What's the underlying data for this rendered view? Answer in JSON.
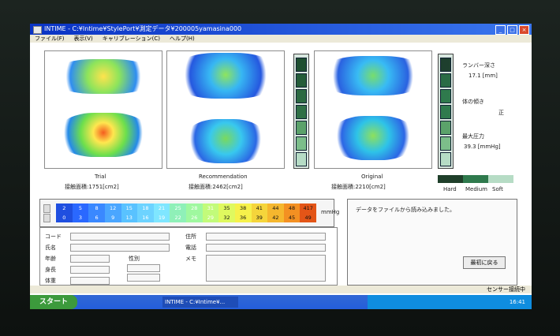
{
  "window": {
    "title": "INTIME - C:¥Intime¥StylePort¥測定データ¥200005yamasina000"
  },
  "menu": [
    "ファイル(F)",
    "表示(V)",
    "キャリブレーション(C)",
    "ヘルプ(H)"
  ],
  "panels": {
    "trial": {
      "caption": "Trial",
      "area_label": "接触面積:1751[cm2]"
    },
    "recommendation": {
      "caption": "Recommendation",
      "area_label": "接触面積:2462[cm2]"
    },
    "original": {
      "caption": "Original",
      "area_label": "接触面積:2210[cm2]"
    }
  },
  "metrics": {
    "lumbar_label": "ランバー深さ",
    "lumbar_value": "17.1 [mm]",
    "tilt_label": "体の傾き",
    "tilt_value": "正",
    "max_pressure_label": "最大圧力",
    "max_pressure_value": "39.3 [mmHg]"
  },
  "firmness_legend": [
    "Hard",
    "Medium",
    "Soft"
  ],
  "legend": {
    "top": [
      "2",
      "5",
      "8",
      "12",
      "15",
      "18",
      "21",
      "25",
      "28",
      "31",
      "35",
      "38",
      "41",
      "44",
      "48",
      "417"
    ],
    "bottom": [
      "0",
      "3",
      "6",
      "9",
      "13",
      "16",
      "19",
      "22",
      "26",
      "29",
      "32",
      "36",
      "39",
      "42",
      "45",
      "49"
    ],
    "unit": "mmHg",
    "colors": [
      "#1f4fe0",
      "#2a68ff",
      "#3a88ff",
      "#4aa6ff",
      "#59c2ff",
      "#6dd3ff",
      "#7fe6ff",
      "#8ff0b8",
      "#9ff89f",
      "#c2fb7a",
      "#dff95f",
      "#f6f14b",
      "#f5d53b",
      "#f5b72e",
      "#f39022",
      "#e35517"
    ]
  },
  "message": "データをファイルから読み込みました。",
  "form": {
    "code_label": "コード",
    "name_label": "氏名",
    "age_label": "年齢",
    "height_label": "身長",
    "weight_label": "体重",
    "sex_label": "性別",
    "address_label": "住所",
    "phone_label": "電話",
    "memo_label": "メモ"
  },
  "buttons": {
    "back": "最初に戻る"
  },
  "taskbar": {
    "start": "スタート",
    "task": "INTIME - C:¥Intime¥...",
    "clock": "16:41"
  },
  "status": "センサー接続中"
}
